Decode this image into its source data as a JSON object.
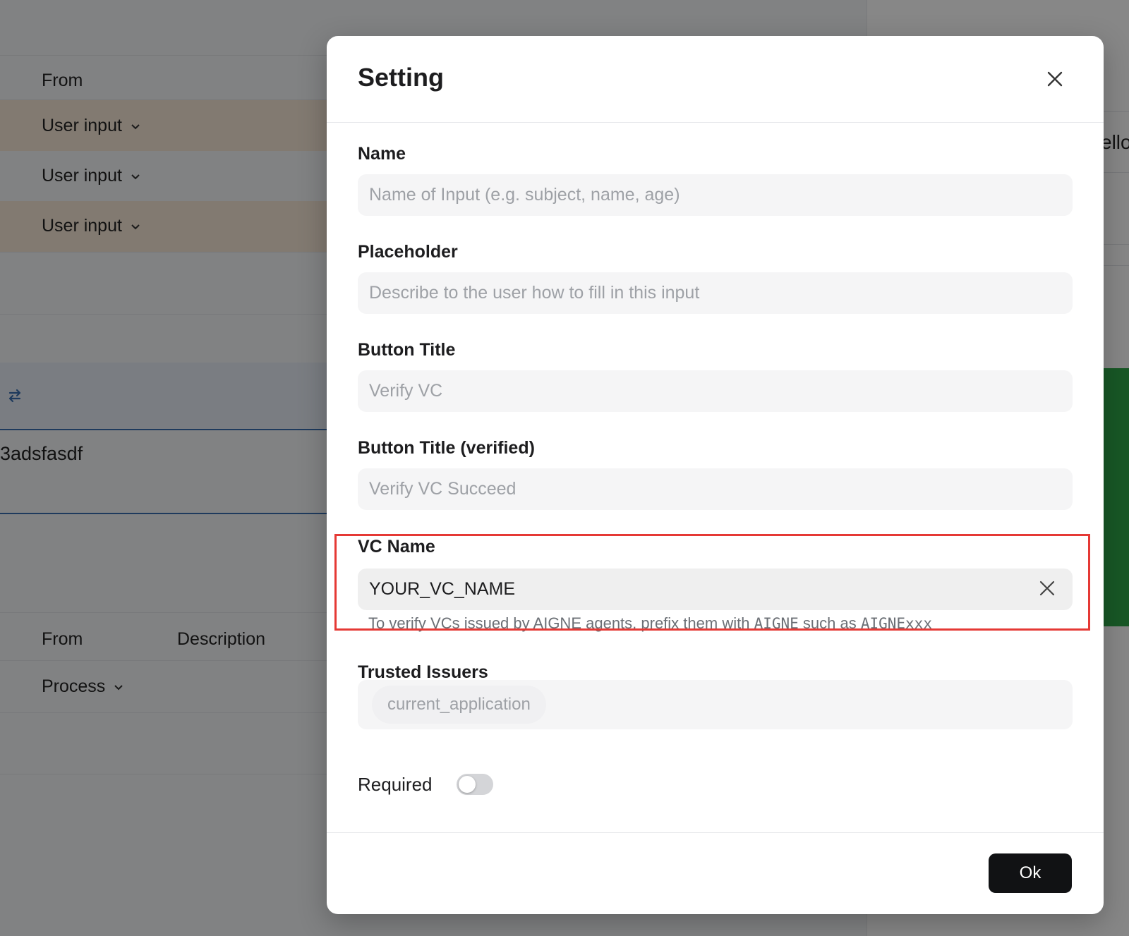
{
  "background": {
    "table1": {
      "header_from": "From",
      "rows": [
        "User input",
        "User input",
        "User input"
      ]
    },
    "value_text": "3adsfasdf",
    "table2": {
      "header_from": "From",
      "header_description": "Description",
      "rows": [
        "Process"
      ]
    },
    "right_peek_text": "ello"
  },
  "modal": {
    "title": "Setting",
    "fields": {
      "name": {
        "label": "Name",
        "placeholder": "Name of Input (e.g. subject, name, age)",
        "value": ""
      },
      "placeholder": {
        "label": "Placeholder",
        "placeholder": "Describe to the user how to fill in this input",
        "value": ""
      },
      "button_title": {
        "label": "Button Title",
        "placeholder": "Verify VC",
        "value": ""
      },
      "button_title_verified": {
        "label": "Button Title (verified)",
        "placeholder": "Verify VC Succeed",
        "value": ""
      },
      "vc_name": {
        "label": "VC Name",
        "value": "YOUR_VC_NAME",
        "helper_prefix": "To verify VCs issued by AIGNE agents, prefix them with ",
        "helper_code1": "AIGNE",
        "helper_mid": " such as ",
        "helper_code2": "AIGNExxx"
      },
      "trusted_issuers": {
        "label": "Trusted Issuers",
        "chip": "current_application"
      }
    },
    "required": {
      "label": "Required",
      "enabled": false
    },
    "ok_label": "Ok"
  },
  "colors": {
    "highlight": "#e53935",
    "ok_button_bg": "#111214",
    "row_highlight": "#f6e6d6"
  }
}
